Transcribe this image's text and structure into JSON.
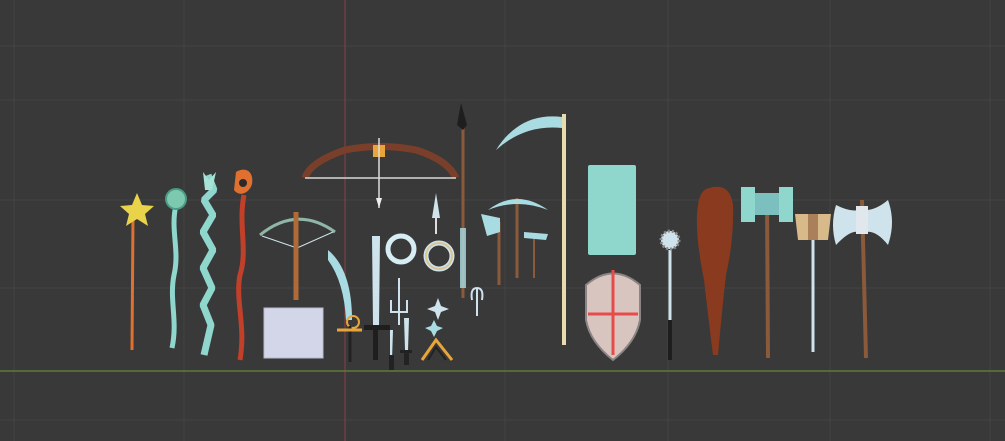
{
  "viewport": {
    "name": "3D Viewport",
    "background": "#393939",
    "grid_color": "#444444",
    "x_axis_color": "#5f7a3a",
    "y_axis_color": "#8a3f46"
  },
  "palette": {
    "gold": "#e8d34a",
    "teal": "#8fd6cc",
    "orange": "#e07030",
    "wood": "#8a5a3a",
    "red_wood": "#c0402a",
    "steel": "#cfe3ec",
    "ice": "#a9dbe3",
    "dark": "#1e1e1e",
    "shield_face": "#d9c5c0",
    "cross": "#e84a4a"
  },
  "objects": [
    {
      "id": "star-staff",
      "icon": "star-staff-icon"
    },
    {
      "id": "orb-staff",
      "icon": "orb-staff-icon"
    },
    {
      "id": "crystal-staff",
      "icon": "crystal-staff-icon"
    },
    {
      "id": "fire-staff",
      "icon": "fire-staff-icon"
    },
    {
      "id": "crossbow",
      "icon": "crossbow-icon"
    },
    {
      "id": "bow",
      "icon": "bow-icon"
    },
    {
      "id": "blank-plane",
      "icon": "plane-icon"
    },
    {
      "id": "scimitar",
      "icon": "scimitar-icon"
    },
    {
      "id": "sword",
      "icon": "sword-icon"
    },
    {
      "id": "rings",
      "icon": "ring-icon"
    },
    {
      "id": "trident",
      "icon": "trident-icon"
    },
    {
      "id": "daggers",
      "icon": "dagger-icon"
    },
    {
      "id": "kunai",
      "icon": "kunai-icon"
    },
    {
      "id": "shuriken",
      "icon": "shuriken-icon"
    },
    {
      "id": "spear",
      "icon": "spear-icon"
    },
    {
      "id": "scythe",
      "icon": "scythe-icon"
    },
    {
      "id": "pickaxe",
      "icon": "pickaxe-icon"
    },
    {
      "id": "hatchets",
      "icon": "hatchet-icon"
    },
    {
      "id": "tower-shield",
      "icon": "tower-shield-icon"
    },
    {
      "id": "kite-shield",
      "icon": "kite-shield-icon"
    },
    {
      "id": "morning-star",
      "icon": "morning-star-icon"
    },
    {
      "id": "club",
      "icon": "club-icon"
    },
    {
      "id": "warhammer",
      "icon": "warhammer-icon"
    },
    {
      "id": "small-axe",
      "icon": "axe-icon"
    },
    {
      "id": "battle-axe",
      "icon": "battle-axe-icon"
    }
  ]
}
